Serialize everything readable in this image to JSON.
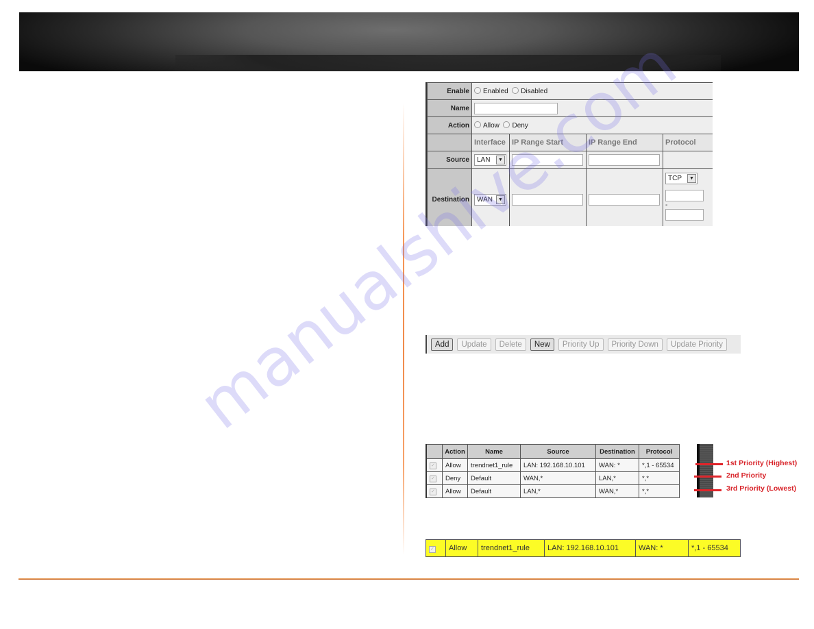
{
  "watermark": "manualshive.com",
  "form": {
    "enable_label": "Enable",
    "enable_options": [
      "Enabled",
      "Disabled"
    ],
    "name_label": "Name",
    "name_value": "",
    "action_label": "Action",
    "action_options": [
      "Allow",
      "Deny"
    ],
    "columns": [
      "Interface",
      "IP Range Start",
      "IP Range End",
      "Protocol"
    ],
    "source_label": "Source",
    "source_interface": "LAN",
    "destination_label": "Destination",
    "destination_interface": "WAN",
    "protocol_value": "TCP",
    "port_separator": "-"
  },
  "buttons": [
    {
      "label": "Add",
      "active": true
    },
    {
      "label": "Update",
      "active": false
    },
    {
      "label": "Delete",
      "active": false
    },
    {
      "label": "New",
      "active": true
    },
    {
      "label": "Priority Up",
      "active": false
    },
    {
      "label": "Priority Down",
      "active": false
    },
    {
      "label": "Update Priority",
      "active": false
    }
  ],
  "rules": {
    "headers": [
      "",
      "Action",
      "Name",
      "Source",
      "Destination",
      "Protocol"
    ],
    "rows": [
      {
        "action": "Allow",
        "name": "trendnet1_rule",
        "source": "LAN: 192.168.10.101",
        "destination": "WAN: *",
        "protocol": "*,1 - 65534"
      },
      {
        "action": "Deny",
        "name": "Default",
        "source": "WAN,*",
        "destination": "LAN,*",
        "protocol": "*,*"
      },
      {
        "action": "Allow",
        "name": "Default",
        "source": "LAN,*",
        "destination": "WAN,*",
        "protocol": "*,*"
      }
    ],
    "priority_labels": [
      "1st Priority (Highest)",
      "2nd Priority",
      "3rd Priority (Lowest)"
    ]
  },
  "highlighted_rule": {
    "action": "Allow",
    "name": "trendnet1_rule",
    "source": "LAN: 192.168.10.101",
    "destination": "WAN: *",
    "protocol": "*,1 - 65534"
  },
  "colors": {
    "accent_orange": "#f08a4a",
    "priority_red": "#d8252b",
    "highlight_yellow": "#fcfc26"
  }
}
